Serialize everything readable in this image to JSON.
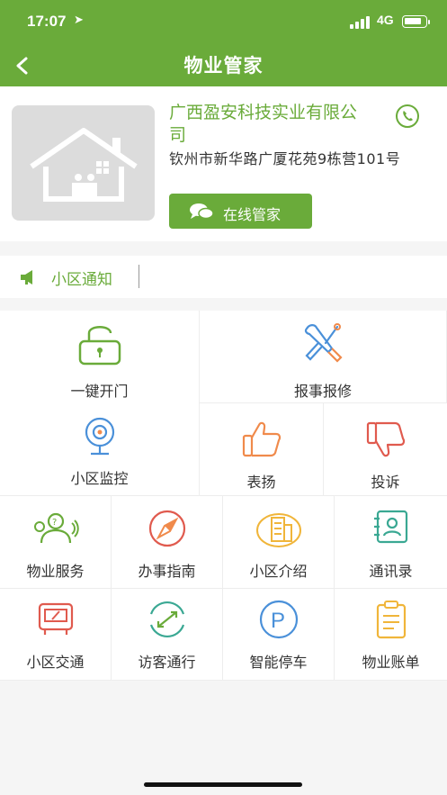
{
  "status": {
    "time": "17:07",
    "network": "4G"
  },
  "nav": {
    "title": "物业管家"
  },
  "company": {
    "name": "广西盈安科技实业有限公司",
    "address": "钦州市新华路广厦花苑9栋营101号",
    "chat_button": "在线管家"
  },
  "notice": {
    "label": "小区通知"
  },
  "grid": [
    {
      "label": "一键开门",
      "icon": "unlock-icon"
    },
    {
      "label": "报事报修",
      "icon": "repair-tools-icon"
    },
    {
      "label": "小区监控",
      "icon": "camera-icon"
    },
    {
      "label": "表扬",
      "icon": "thumbs-up-icon"
    },
    {
      "label": "投诉",
      "icon": "thumbs-down-icon"
    },
    {
      "label": "物业服务",
      "icon": "service-people-icon"
    },
    {
      "label": "办事指南",
      "icon": "compass-icon"
    },
    {
      "label": "小区介绍",
      "icon": "building-icon"
    },
    {
      "label": "通讯录",
      "icon": "contacts-icon"
    },
    {
      "label": "小区交通",
      "icon": "bus-icon"
    },
    {
      "label": "访客通行",
      "icon": "visitor-pass-icon"
    },
    {
      "label": "智能停车",
      "icon": "parking-icon"
    },
    {
      "label": "物业账单",
      "icon": "bill-icon"
    }
  ],
  "colors": {
    "brand": "#6aab3a",
    "orange": "#f08a4b",
    "blue": "#4a90d9",
    "yellow": "#f0b53a",
    "red": "#e05a4e",
    "teal": "#3aa893"
  }
}
